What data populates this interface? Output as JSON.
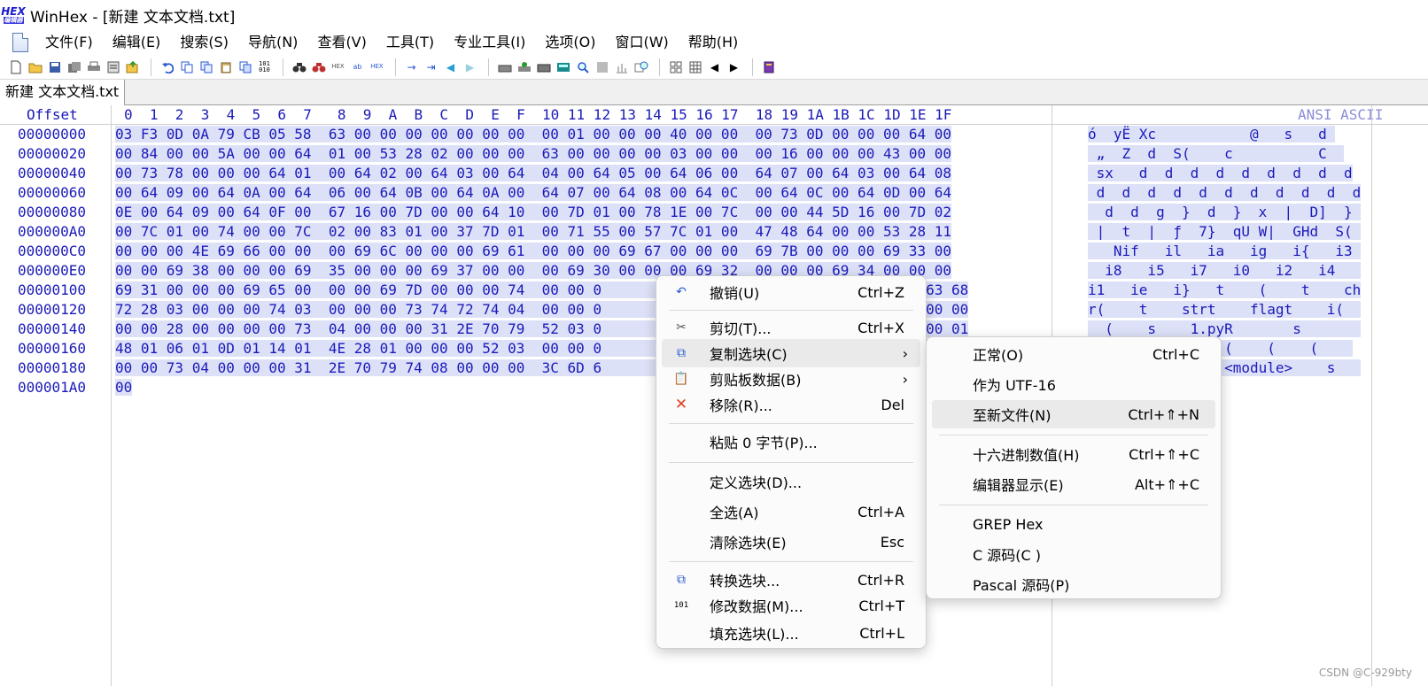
{
  "window": {
    "title": "WinHex - [新建 文本文档.txt]",
    "logo_top": "HEX",
    "logo_bottom": "编辑器"
  },
  "menubar": [
    "文件(F)",
    "编辑(E)",
    "搜索(S)",
    "导航(N)",
    "查看(V)",
    "工具(T)",
    "专业工具(I)",
    "选项(O)",
    "窗口(W)",
    "帮助(H)"
  ],
  "tab": {
    "label": "新建 文本文档.txt"
  },
  "header": {
    "offset": "Offset",
    "hex": "0  1  2  3  4  5  6  7   8  9  A  B  C  D  E  F  10 11 12 13 14 15 16 17  18 19 1A 1B 1C 1D 1E 1F",
    "ansi": "ANSI ASCII"
  },
  "rows": [
    {
      "offset": "00000000",
      "hex": "03 F3 0D 0A 79 CB 05 58  63 00 00 00 00 00 00 00  00 01 00 00 00 40 00 00  00 73 0D 00 00 00 64 00",
      "ansi": "ó  yË Xc           @   s   d "
    },
    {
      "offset": "00000020",
      "hex": "00 84 00 00 5A 00 00 64  01 00 53 28 02 00 00 00  63 00 00 00 00 03 00 00  00 16 00 00 00 43 00 00",
      "ansi": " „  Z  d  S(    c          C  "
    },
    {
      "offset": "00000040",
      "hex": "00 73 78 00 00 00 64 01  00 64 02 00 64 03 00 64  04 00 64 05 00 64 06 00  64 07 00 64 03 00 64 08",
      "ansi": " sx   d  d  d  d  d  d  d  d  d"
    },
    {
      "offset": "00000060",
      "hex": "00 64 09 00 64 0A 00 64  06 00 64 0B 00 64 0A 00  64 07 00 64 08 00 64 0C  00 64 0C 00 64 0D 00 64",
      "ansi": " d  d  d  d  d  d  d  d  d  d  d"
    },
    {
      "offset": "00000080",
      "hex": "0E 00 64 09 00 64 0F 00  67 16 00 7D 00 00 64 10  00 7D 01 00 78 1E 00 7C  00 00 44 5D 16 00 7D 02",
      "ansi": "  d  d  g  }  d  }  x  |  D]  } "
    },
    {
      "offset": "000000A0",
      "hex": "00 7C 01 00 74 00 00 7C  02 00 83 01 00 37 7D 01  00 71 55 00 57 7C 01 00  47 48 64 00 00 53 28 11",
      "ansi": " |  t  |  ƒ  7}  qU W|  GHd  S( "
    },
    {
      "offset": "000000C0",
      "hex": "00 00 00 4E 69 66 00 00  00 69 6C 00 00 00 69 61  00 00 00 69 67 00 00 00  69 7B 00 00 00 69 33 00",
      "ansi": "   Nif   il   ia   ig   i{   i3 "
    },
    {
      "offset": "000000E0",
      "hex": "00 00 69 38 00 00 00 69  35 00 00 00 69 37 00 00  00 69 30 00 00 00 69 32  00 00 00 69 34 00 00 00",
      "ansi": "  i8   i5   i7   i0   i2   i4   "
    },
    {
      "offset": "00000100",
      "hex": "69 31 00 00 00 69 65 00  00 00 69 7D 00 00 00 74  00 00 0                                00 00 63 68",
      "ansi": "i1   ie   i}   t    (    t    ch"
    },
    {
      "offset": "00000120",
      "hex": "72 28 03 00 00 00 74 03  00 00 00 73 74 72 74 04  00 00 0                                69 28 00 00",
      "ansi": "r(    t    strt    flagt    i(  "
    },
    {
      "offset": "00000140",
      "hex": "00 00 28 00 00 00 00 73  04 00 00 00 31 2E 70 79  52 03 0                                00 00 00 01",
      "ansi": "  (    s    1.pyR       s       "
    },
    {
      "offset": "00000160",
      "hex": "48 01 06 01 0D 01 14 01  4E 28 01 00 00 00 52 03  00 00 0                                           ",
      "ansi": "H    N(    R    (    (    (    "
    },
    {
      "offset": "00000180",
      "hex": "00 00 73 04 00 00 00 31  2E 70 79 74 08 00 00 00  3C 6D 6                                          ",
      "ansi": "  s    1.pyt    <module>    s   "
    },
    {
      "offset": "000001A0",
      "hex": "00",
      "ansi": ""
    }
  ],
  "context_menu": {
    "items": [
      {
        "icon": "↶",
        "label": "撤销(U)",
        "shortcut": "Ctrl+Z"
      },
      {
        "icon": "✂",
        "label": "剪切(T)...",
        "shortcut": "Ctrl+X"
      },
      {
        "icon": "⧉",
        "label": "复制选块(C)",
        "shortcut": "",
        "submenu": true
      },
      {
        "icon": "📋",
        "label": "剪贴板数据(B)",
        "shortcut": "",
        "submenu": true
      },
      {
        "icon": "✕",
        "label": "移除(R)...",
        "shortcut": "Del"
      },
      {
        "icon": "",
        "label": "粘贴 0 字节(P)...",
        "shortcut": ""
      },
      {
        "icon": "",
        "label": "定义选块(D)...",
        "shortcut": ""
      },
      {
        "icon": "",
        "label": "全选(A)",
        "shortcut": "Ctrl+A"
      },
      {
        "icon": "",
        "label": "清除选块(E)",
        "shortcut": "Esc"
      },
      {
        "icon": "⧉",
        "label": "转换选块...",
        "shortcut": "Ctrl+R"
      },
      {
        "icon": "101",
        "label": "修改数据(M)...",
        "shortcut": "Ctrl+T"
      },
      {
        "icon": "",
        "label": "填充选块(L)...",
        "shortcut": "Ctrl+L"
      }
    ]
  },
  "submenu": {
    "items": [
      {
        "label": "正常(O)",
        "shortcut": "Ctrl+C"
      },
      {
        "label": "作为 UTF-16",
        "shortcut": ""
      },
      {
        "label": "至新文件(N)",
        "shortcut": "Ctrl+⇑+N"
      },
      {
        "label": "十六进制数值(H)",
        "shortcut": "Ctrl+⇑+C"
      },
      {
        "label": "编辑器显示(E)",
        "shortcut": "Alt+⇑+C"
      },
      {
        "label": "GREP Hex",
        "shortcut": ""
      },
      {
        "label": "C 源码(C )",
        "shortcut": ""
      },
      {
        "label": "Pascal 源码(P)",
        "shortcut": ""
      }
    ]
  },
  "watermark": "CSDN @C-929bty",
  "colors": {
    "hex_text": "#1a1ab8",
    "selection": "#dde1f8",
    "remove_icon": "#e04020"
  }
}
